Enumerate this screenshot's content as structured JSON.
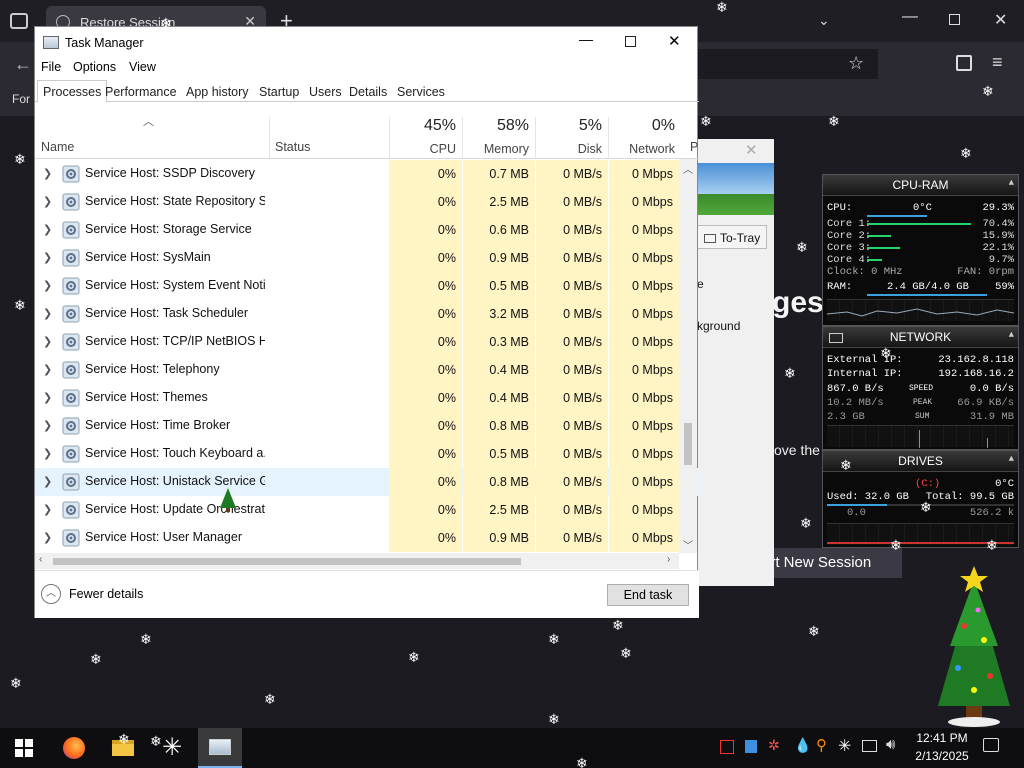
{
  "browser": {
    "tab_title": "Restore Session",
    "page_fragment_left": "For",
    "headline_fragment": "ges",
    "text_fragment": "ove the",
    "button_fragment": "art New Session",
    "button_underline_letter": "N"
  },
  "task_manager": {
    "title": "Task Manager",
    "menu": [
      "File",
      "Options",
      "View"
    ],
    "tabs": [
      "Processes",
      "Performance",
      "App history",
      "Startup",
      "Users",
      "Details",
      "Services"
    ],
    "columns": {
      "name": "Name",
      "status": "Status",
      "cpu": {
        "pct": "45%",
        "label": "CPU"
      },
      "memory": {
        "pct": "58%",
        "label": "Memory"
      },
      "disk": {
        "pct": "5%",
        "label": "Disk"
      },
      "network": {
        "pct": "0%",
        "label": "Network"
      },
      "power": "P"
    },
    "rows": [
      {
        "name": "Service Host: SSDP Discovery",
        "cpu": "0%",
        "memory": "0.7 MB",
        "disk": "0 MB/s",
        "network": "0 Mbps"
      },
      {
        "name": "Service Host: State Repository S...",
        "cpu": "0%",
        "memory": "2.5 MB",
        "disk": "0 MB/s",
        "network": "0 Mbps"
      },
      {
        "name": "Service Host: Storage Service",
        "cpu": "0%",
        "memory": "0.6 MB",
        "disk": "0 MB/s",
        "network": "0 Mbps"
      },
      {
        "name": "Service Host: SysMain",
        "cpu": "0%",
        "memory": "0.9 MB",
        "disk": "0 MB/s",
        "network": "0 Mbps"
      },
      {
        "name": "Service Host: System Event Noti...",
        "cpu": "0%",
        "memory": "0.5 MB",
        "disk": "0 MB/s",
        "network": "0 Mbps"
      },
      {
        "name": "Service Host: Task Scheduler",
        "cpu": "0%",
        "memory": "3.2 MB",
        "disk": "0 MB/s",
        "network": "0 Mbps"
      },
      {
        "name": "Service Host: TCP/IP NetBIOS H...",
        "cpu": "0%",
        "memory": "0.3 MB",
        "disk": "0 MB/s",
        "network": "0 Mbps"
      },
      {
        "name": "Service Host: Telephony",
        "cpu": "0%",
        "memory": "0.4 MB",
        "disk": "0 MB/s",
        "network": "0 Mbps"
      },
      {
        "name": "Service Host: Themes",
        "cpu": "0%",
        "memory": "0.4 MB",
        "disk": "0 MB/s",
        "network": "0 Mbps"
      },
      {
        "name": "Service Host: Time Broker",
        "cpu": "0%",
        "memory": "0.8 MB",
        "disk": "0 MB/s",
        "network": "0 Mbps"
      },
      {
        "name": "Service Host: Touch Keyboard a...",
        "cpu": "0%",
        "memory": "0.5 MB",
        "disk": "0 MB/s",
        "network": "0 Mbps"
      },
      {
        "name": "Service Host: Unistack Service G...",
        "cpu": "0%",
        "memory": "0.8 MB",
        "disk": "0 MB/s",
        "network": "0 Mbps"
      },
      {
        "name": "Service Host: Update Orchestrat...",
        "cpu": "0%",
        "memory": "2.5 MB",
        "disk": "0 MB/s",
        "network": "0 Mbps"
      },
      {
        "name": "Service Host: User Manager",
        "cpu": "0%",
        "memory": "0.9 MB",
        "disk": "0 MB/s",
        "network": "0 Mbps"
      }
    ],
    "fewer_details": "Fewer details",
    "end_task": "End task"
  },
  "second_window": {
    "to_tray": "To-Tray",
    "fragment1": "e",
    "fragment2": "kground"
  },
  "cpu_ram_gadget": {
    "title": "CPU-RAM",
    "cpu_label": "CPU:",
    "cpu_temp": "0°C",
    "cpu_pct": "29.3%",
    "cores": [
      {
        "label": "Core 1:",
        "pct": "70.4%"
      },
      {
        "label": "Core 2:",
        "pct": "15.9%"
      },
      {
        "label": "Core 3:",
        "pct": "22.1%"
      },
      {
        "label": "Core 4:",
        "pct": "9.7%"
      }
    ],
    "clock": "Clock: 0 MHz",
    "fan": "FAN: 0rpm",
    "ram_label": "RAM:",
    "ram_value": "2.4 GB/4.0 GB",
    "ram_pct": "59%"
  },
  "network_gadget": {
    "title": "NETWORK",
    "external_label": "External IP:",
    "external_ip": "23.162.8.118",
    "internal_label": "Internal IP:",
    "internal_ip": "192.168.16.2",
    "speed_down": "867.0 B/s",
    "speed_label": "SPEED",
    "speed_up": "0.0 B/s",
    "peak_down": "10.2 MB/s",
    "peak_label": "PEAK",
    "peak_up": "66.9 KB/s",
    "sum_down": "2.3 GB",
    "sum_label": "SUM",
    "sum_up": "31.9 MB"
  },
  "drives_gadget": {
    "title": "DRIVES",
    "drive": "(C:)",
    "temp": "0°C",
    "used": "Used: 32.0 GB",
    "total": "Total: 99.5 GB",
    "read": "0.0",
    "write": "526.2 k"
  },
  "taskbar": {
    "time": "12:41 PM",
    "date": "2/13/2025"
  },
  "colors": {
    "cell_highlight": "#fff4c4",
    "hover_row": "#e5f3ff",
    "accent": "#0078d7"
  }
}
